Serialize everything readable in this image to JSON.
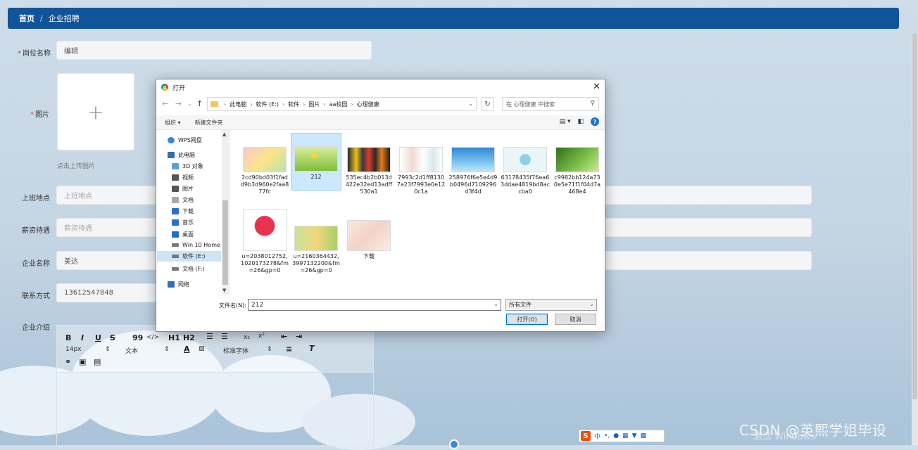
{
  "breadcrumb": {
    "home": "首页",
    "separator": "/",
    "current": "企业招聘"
  },
  "form": {
    "position_name": {
      "label": "岗位名称",
      "value": "编辑"
    },
    "image": {
      "label": "图片",
      "plus": "+",
      "hint": "点击上传图片"
    },
    "work_location": {
      "label": "上班地点",
      "placeholder": "上班地点"
    },
    "salary": {
      "label": "薪资待遇",
      "placeholder": "薪资待遇"
    },
    "company_name": {
      "label": "企业名称",
      "value": "美达"
    },
    "contact": {
      "label": "联系方式",
      "value": "13612547848"
    },
    "intro": {
      "label": "企业介绍"
    },
    "required_mark": "*"
  },
  "editor": {
    "bold": "B",
    "italic": "I",
    "underline": "U",
    "strike": "S",
    "quote": "99",
    "code": "</>",
    "h1": "H1",
    "h2": "H2",
    "sub": "x₂",
    "sup": "x²",
    "font_size": "14px",
    "text_type": "文本",
    "font_family": "标准字体"
  },
  "dialog": {
    "title": "打开",
    "close": "✕",
    "address": [
      "此电脑",
      "软件 (E:)",
      "软件",
      "图片",
      "aa校园",
      "心理健康"
    ],
    "search_placeholder": "在 心理健康 中搜索",
    "organize": "组织 ▾",
    "new_folder": "新建文件夹",
    "sidebar": [
      {
        "label": "WPS网盘",
        "color": "#3b82d6"
      },
      {
        "label": "此电脑",
        "color": "#2f6fb8"
      },
      {
        "label": "3D 对象",
        "color": "#5aa0d8"
      },
      {
        "label": "视频",
        "color": "#555"
      },
      {
        "label": "图片",
        "color": "#555"
      },
      {
        "label": "文档",
        "color": "#777"
      },
      {
        "label": "下载",
        "color": "#2d6fd0"
      },
      {
        "label": "音乐",
        "color": "#2d6fd0"
      },
      {
        "label": "桌面",
        "color": "#1f6fc9"
      },
      {
        "label": "Win 10 Home",
        "color": "#666"
      },
      {
        "label": "软件 (E:)",
        "color": "#666"
      },
      {
        "label": "文档 (F:)",
        "color": "#666"
      },
      {
        "label": "网络",
        "color": "#2f6fb8"
      }
    ],
    "files": [
      {
        "name": "2cd90bd03f1fadd9b3d960e2faa877fc"
      },
      {
        "name": "212"
      },
      {
        "name": "535ec4b2b013d422e32ed13adff530a1"
      },
      {
        "name": "7993c2d1ff81307a23f7993e0e120c1a"
      },
      {
        "name": "258976f6e5e4d9b0496d7109296d3f4d"
      },
      {
        "name": "63178435f76ea63ddae4819bd8accba0"
      },
      {
        "name": "c9982bb124a730e5e71f1f04d7a468e4"
      },
      {
        "name": "u=2038012752,1020173278&fm=26&gp=0"
      },
      {
        "name": "u=2160364432,3997132200&fm=26&gp=0"
      },
      {
        "name": "下载"
      }
    ],
    "filename_label": "文件名(N):",
    "filename_value": "212",
    "filetype_value": "所有文件",
    "open_button": "打开(O)",
    "cancel_button": "取消"
  },
  "ime": {
    "logo": "S",
    "lang": "中"
  },
  "watermark": "CSDN @英熙学姐毕设",
  "activate_text": "激活 Windows"
}
